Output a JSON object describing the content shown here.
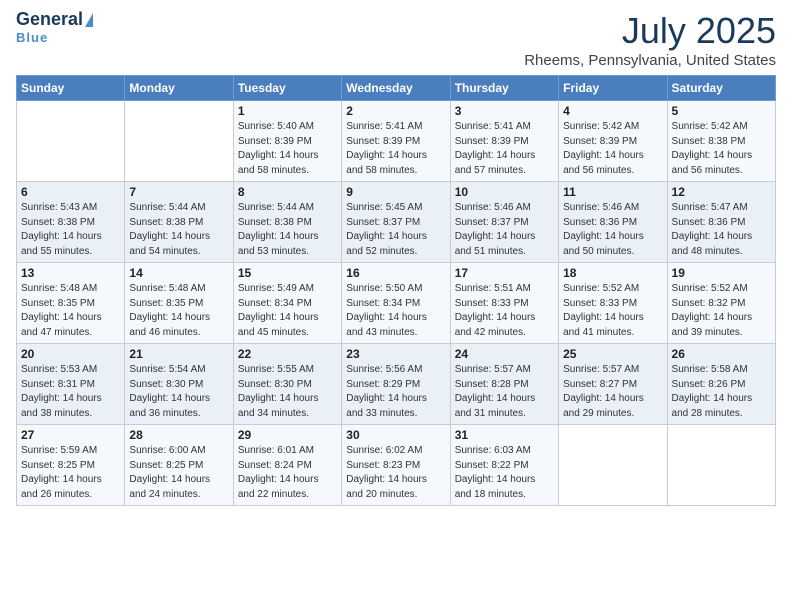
{
  "logo": {
    "line1": "General",
    "line2": "Blue"
  },
  "header": {
    "title": "July 2025",
    "location": "Rheems, Pennsylvania, United States"
  },
  "days_of_week": [
    "Sunday",
    "Monday",
    "Tuesday",
    "Wednesday",
    "Thursday",
    "Friday",
    "Saturday"
  ],
  "weeks": [
    [
      {
        "day": "",
        "info": ""
      },
      {
        "day": "",
        "info": ""
      },
      {
        "day": "1",
        "info": "Sunrise: 5:40 AM\nSunset: 8:39 PM\nDaylight: 14 hours and 58 minutes."
      },
      {
        "day": "2",
        "info": "Sunrise: 5:41 AM\nSunset: 8:39 PM\nDaylight: 14 hours and 58 minutes."
      },
      {
        "day": "3",
        "info": "Sunrise: 5:41 AM\nSunset: 8:39 PM\nDaylight: 14 hours and 57 minutes."
      },
      {
        "day": "4",
        "info": "Sunrise: 5:42 AM\nSunset: 8:39 PM\nDaylight: 14 hours and 56 minutes."
      },
      {
        "day": "5",
        "info": "Sunrise: 5:42 AM\nSunset: 8:38 PM\nDaylight: 14 hours and 56 minutes."
      }
    ],
    [
      {
        "day": "6",
        "info": "Sunrise: 5:43 AM\nSunset: 8:38 PM\nDaylight: 14 hours and 55 minutes."
      },
      {
        "day": "7",
        "info": "Sunrise: 5:44 AM\nSunset: 8:38 PM\nDaylight: 14 hours and 54 minutes."
      },
      {
        "day": "8",
        "info": "Sunrise: 5:44 AM\nSunset: 8:38 PM\nDaylight: 14 hours and 53 minutes."
      },
      {
        "day": "9",
        "info": "Sunrise: 5:45 AM\nSunset: 8:37 PM\nDaylight: 14 hours and 52 minutes."
      },
      {
        "day": "10",
        "info": "Sunrise: 5:46 AM\nSunset: 8:37 PM\nDaylight: 14 hours and 51 minutes."
      },
      {
        "day": "11",
        "info": "Sunrise: 5:46 AM\nSunset: 8:36 PM\nDaylight: 14 hours and 50 minutes."
      },
      {
        "day": "12",
        "info": "Sunrise: 5:47 AM\nSunset: 8:36 PM\nDaylight: 14 hours and 48 minutes."
      }
    ],
    [
      {
        "day": "13",
        "info": "Sunrise: 5:48 AM\nSunset: 8:35 PM\nDaylight: 14 hours and 47 minutes."
      },
      {
        "day": "14",
        "info": "Sunrise: 5:48 AM\nSunset: 8:35 PM\nDaylight: 14 hours and 46 minutes."
      },
      {
        "day": "15",
        "info": "Sunrise: 5:49 AM\nSunset: 8:34 PM\nDaylight: 14 hours and 45 minutes."
      },
      {
        "day": "16",
        "info": "Sunrise: 5:50 AM\nSunset: 8:34 PM\nDaylight: 14 hours and 43 minutes."
      },
      {
        "day": "17",
        "info": "Sunrise: 5:51 AM\nSunset: 8:33 PM\nDaylight: 14 hours and 42 minutes."
      },
      {
        "day": "18",
        "info": "Sunrise: 5:52 AM\nSunset: 8:33 PM\nDaylight: 14 hours and 41 minutes."
      },
      {
        "day": "19",
        "info": "Sunrise: 5:52 AM\nSunset: 8:32 PM\nDaylight: 14 hours and 39 minutes."
      }
    ],
    [
      {
        "day": "20",
        "info": "Sunrise: 5:53 AM\nSunset: 8:31 PM\nDaylight: 14 hours and 38 minutes."
      },
      {
        "day": "21",
        "info": "Sunrise: 5:54 AM\nSunset: 8:30 PM\nDaylight: 14 hours and 36 minutes."
      },
      {
        "day": "22",
        "info": "Sunrise: 5:55 AM\nSunset: 8:30 PM\nDaylight: 14 hours and 34 minutes."
      },
      {
        "day": "23",
        "info": "Sunrise: 5:56 AM\nSunset: 8:29 PM\nDaylight: 14 hours and 33 minutes."
      },
      {
        "day": "24",
        "info": "Sunrise: 5:57 AM\nSunset: 8:28 PM\nDaylight: 14 hours and 31 minutes."
      },
      {
        "day": "25",
        "info": "Sunrise: 5:57 AM\nSunset: 8:27 PM\nDaylight: 14 hours and 29 minutes."
      },
      {
        "day": "26",
        "info": "Sunrise: 5:58 AM\nSunset: 8:26 PM\nDaylight: 14 hours and 28 minutes."
      }
    ],
    [
      {
        "day": "27",
        "info": "Sunrise: 5:59 AM\nSunset: 8:25 PM\nDaylight: 14 hours and 26 minutes."
      },
      {
        "day": "28",
        "info": "Sunrise: 6:00 AM\nSunset: 8:25 PM\nDaylight: 14 hours and 24 minutes."
      },
      {
        "day": "29",
        "info": "Sunrise: 6:01 AM\nSunset: 8:24 PM\nDaylight: 14 hours and 22 minutes."
      },
      {
        "day": "30",
        "info": "Sunrise: 6:02 AM\nSunset: 8:23 PM\nDaylight: 14 hours and 20 minutes."
      },
      {
        "day": "31",
        "info": "Sunrise: 6:03 AM\nSunset: 8:22 PM\nDaylight: 14 hours and 18 minutes."
      },
      {
        "day": "",
        "info": ""
      },
      {
        "day": "",
        "info": ""
      }
    ]
  ]
}
